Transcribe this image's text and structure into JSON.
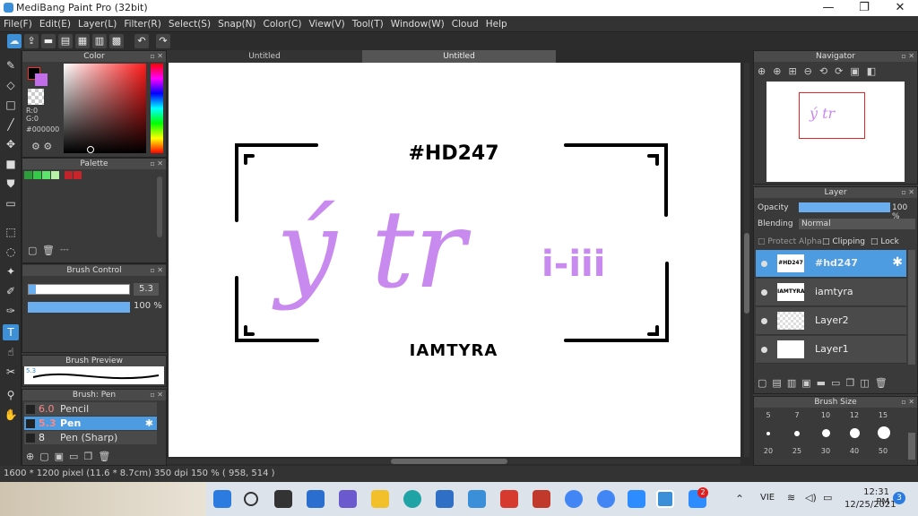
{
  "app": {
    "title": "MediBang Paint Pro (32bit)"
  },
  "menu": [
    "File(F)",
    "Edit(E)",
    "Layer(L)",
    "Filter(R)",
    "Select(S)",
    "Snap(N)",
    "Color(C)",
    "View(V)",
    "Tool(T)",
    "Window(W)",
    "Cloud",
    "Help"
  ],
  "window_controls": {
    "minimize": "—",
    "maximize": "❐",
    "close": "✕"
  },
  "tabs": [
    {
      "label": "Untitled"
    },
    {
      "label": "Untitled"
    }
  ],
  "color_panel": {
    "title": "Color",
    "r": "R:0",
    "g": "G:0",
    "hex": "#000000"
  },
  "palette_panel": {
    "title": "Palette",
    "more": "---",
    "swatches": [
      "#2e9e3c",
      "#35c94a",
      "#5ee36c",
      "#b7f0a7",
      "#c0242a",
      "#c8242a"
    ]
  },
  "brush_control": {
    "title": "Brush Control",
    "size": "5.3",
    "opacity": "100 %"
  },
  "brush_preview": {
    "title": "Brush Preview",
    "size": "5.3"
  },
  "brush_list": {
    "title": "Brush: Pen",
    "items": [
      {
        "size": "6.0",
        "name": "Pencil"
      },
      {
        "size": "5.3",
        "name": "Pen"
      },
      {
        "size": "8",
        "name": "Pen (Sharp)"
      }
    ]
  },
  "navigator": {
    "title": "Navigator"
  },
  "layer_panel": {
    "title": "Layer",
    "opacity_label": "Opacity",
    "opacity": "100 %",
    "blending_label": "Blending",
    "blending": "Normal",
    "protect_alpha": "Protect Alpha",
    "clipping": "Clipping",
    "lock": "Lock",
    "layers": [
      {
        "name": "#hd247",
        "thumb": "#HD247"
      },
      {
        "name": "iamtyra",
        "thumb": "IAMTYRA"
      },
      {
        "name": "Layer2",
        "thumb": ""
      },
      {
        "name": "Layer1",
        "thumb": ""
      }
    ]
  },
  "brush_size": {
    "title": "Brush Size",
    "row1": [
      "5",
      "7",
      "10",
      "12",
      "15"
    ],
    "row2": [
      "20",
      "25",
      "30",
      "40",
      "50"
    ]
  },
  "artwork": {
    "top_text": "#HD247",
    "main_text": "ý tr",
    "side_text": "i-iii",
    "bottom_text": "IAMTYRA",
    "accent": "#c98af0"
  },
  "status": {
    "text": "1600 * 1200 pixel   (11.6 * 8.7cm)   350 dpi   150 %   ( 958, 514 )"
  },
  "taskbar": {
    "lang": "VIE",
    "time": "12:31 PM",
    "date": "12/25/2021",
    "notif": "3",
    "badge": "2"
  }
}
